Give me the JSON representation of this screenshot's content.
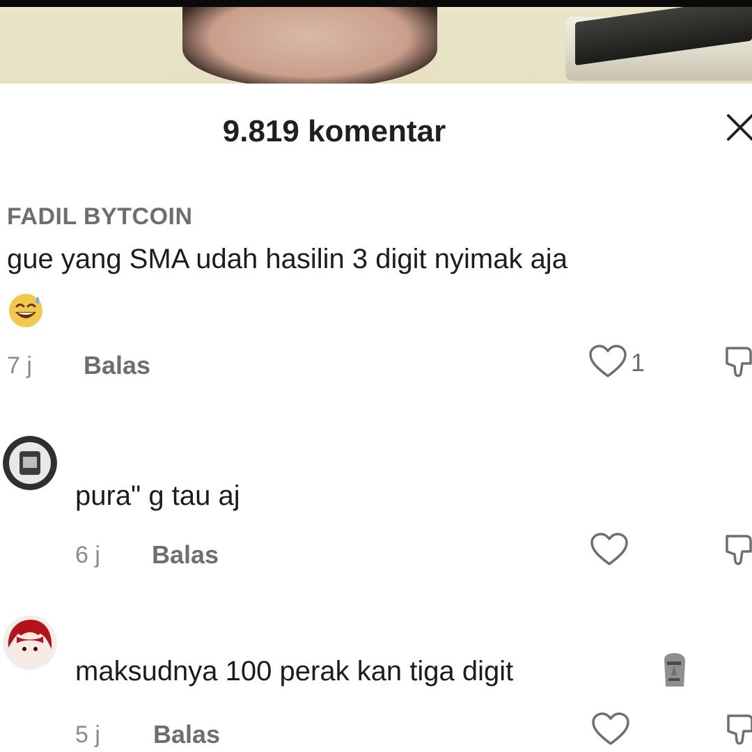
{
  "header": {
    "comment_count_title": "9.819 komentar"
  },
  "comments": [
    {
      "username": "FADIL BYTCOIN",
      "text": "gue yang SMA udah hasilin 3 digit nyimak aja",
      "emoji": "grinning-sweat-emoji",
      "time": "7 j",
      "reply_label": "Balas",
      "like_count": "1"
    },
    {
      "username": "",
      "text": "pura\" g tau aj",
      "time": "6 j",
      "reply_label": "Balas",
      "like_count": ""
    },
    {
      "username": "",
      "text": "maksudnya 100 perak kan tiga digit",
      "emoji": "moai-emoji",
      "time": "5 j",
      "reply_label": "Balas",
      "like_count": ""
    }
  ],
  "colors": {
    "text_primary": "#1c1c1c",
    "text_secondary": "#6d6e74",
    "background": "#ffffff"
  }
}
